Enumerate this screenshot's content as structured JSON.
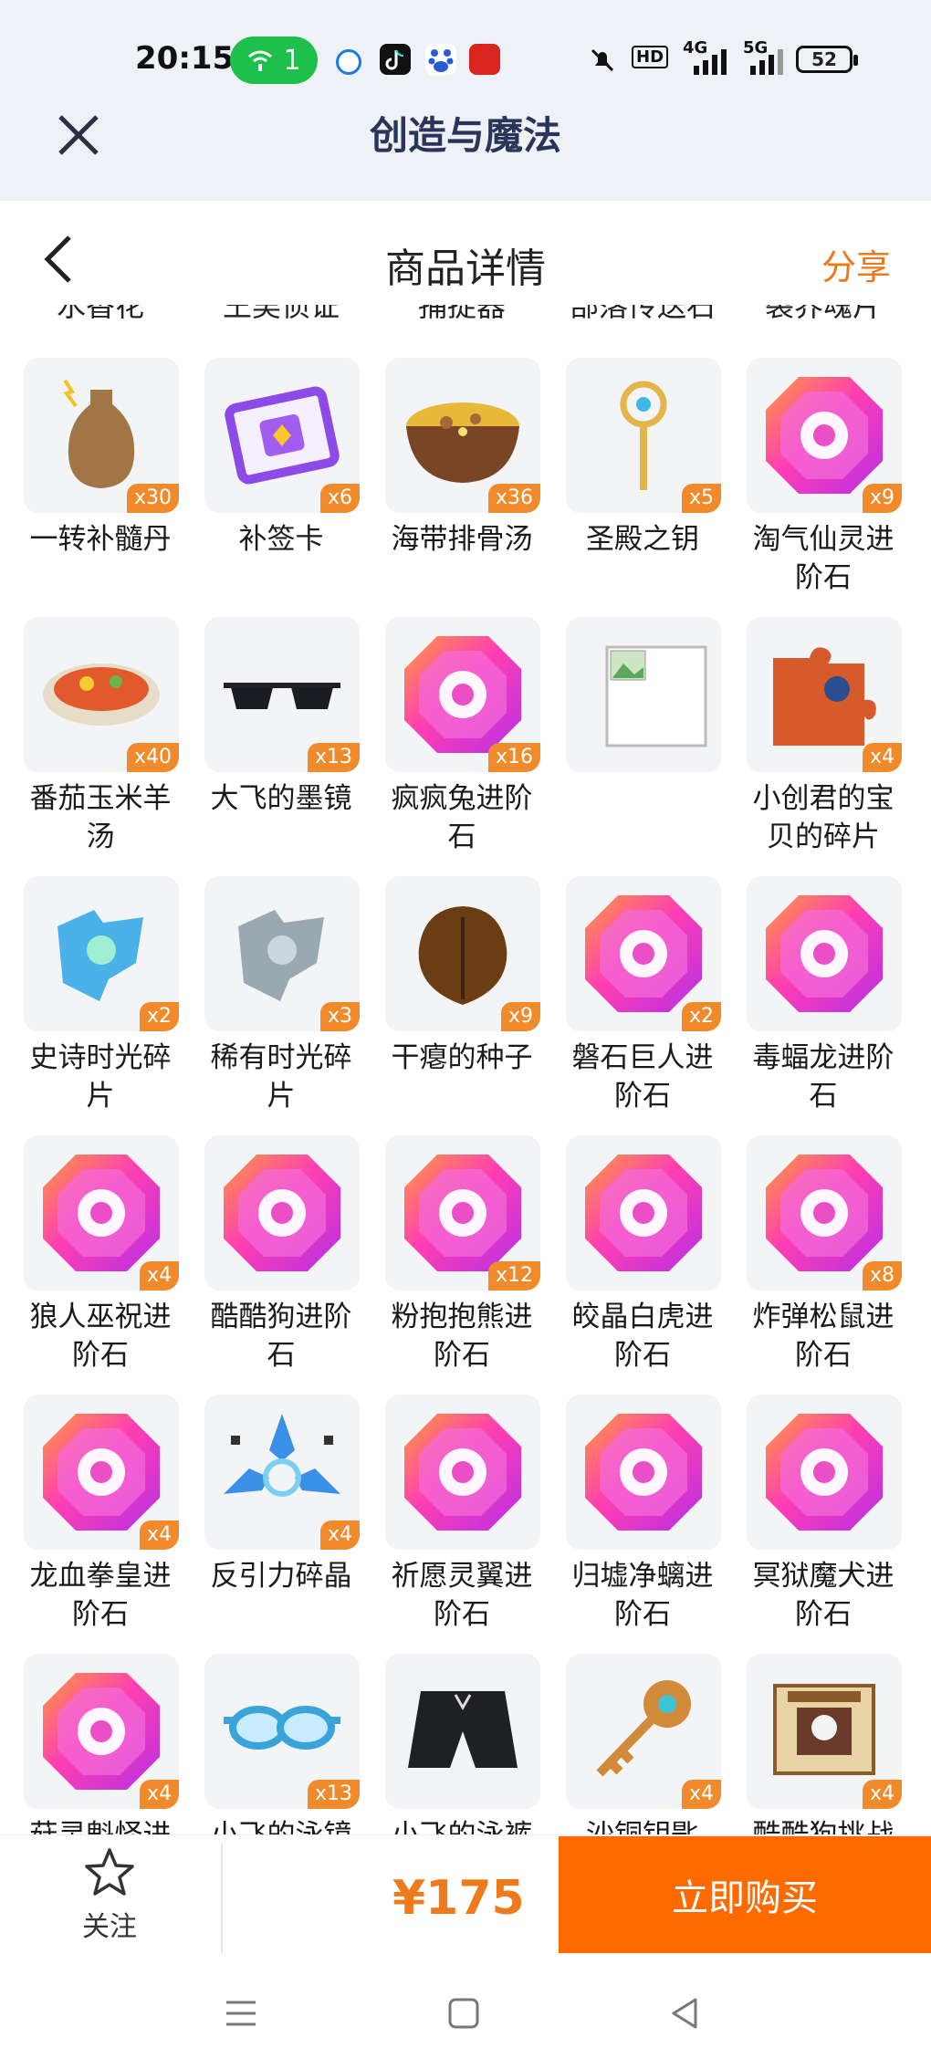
{
  "status_bar": {
    "time": "20:15",
    "hotspot_count": "1",
    "hd_label": "HD",
    "net1": "4G",
    "net2": "5G",
    "battery": "52"
  },
  "app_bar": {
    "title": "创造与魔法"
  },
  "header": {
    "title": "商品详情",
    "share_label": "分享"
  },
  "cut_row": [
    "水香花",
    "王吴侦证",
    "捕捉器",
    "部落传送石",
    "裂界魂片"
  ],
  "items": [
    {
      "name": "一转补髓丹",
      "qty": "x30",
      "icon": "vase-icon"
    },
    {
      "name": "补签卡",
      "qty": "x6",
      "icon": "ticket-icon"
    },
    {
      "name": "海带排骨汤",
      "qty": "x36",
      "icon": "soup-bowl-icon"
    },
    {
      "name": "圣殿之钥",
      "qty": "x5",
      "icon": "scepter-key-icon"
    },
    {
      "name": "淘气仙灵进阶石",
      "qty": "x9",
      "icon": "gem-icon"
    },
    {
      "name": "番茄玉米羊汤",
      "qty": "x40",
      "icon": "stew-pot-icon"
    },
    {
      "name": "大飞的墨镜",
      "qty": "x13",
      "icon": "sunglasses-icon"
    },
    {
      "name": "疯疯兔进阶石",
      "qty": "x16",
      "icon": "gem-icon"
    },
    {
      "name": "",
      "qty": "",
      "icon": "broken-image-icon"
    },
    {
      "name": "小创君的宝贝的碎片",
      "qty": "x4",
      "icon": "puzzle-icon"
    },
    {
      "name": "史诗时光碎片",
      "qty": "x2",
      "icon": "blue-shard-icon"
    },
    {
      "name": "稀有时光碎片",
      "qty": "x3",
      "icon": "grey-shard-icon"
    },
    {
      "name": "干瘪的种子",
      "qty": "x9",
      "icon": "seed-icon"
    },
    {
      "name": "磐石巨人进阶石",
      "qty": "x2",
      "icon": "gem-icon"
    },
    {
      "name": "毒蝠龙进阶石",
      "qty": "",
      "icon": "gem-icon"
    },
    {
      "name": "狼人巫祝进阶石",
      "qty": "x4",
      "icon": "gem-icon"
    },
    {
      "name": "酷酷狗进阶石",
      "qty": "",
      "icon": "gem-icon"
    },
    {
      "name": "粉抱抱熊进阶石",
      "qty": "x12",
      "icon": "gem-icon"
    },
    {
      "name": "皎晶白虎进阶石",
      "qty": "",
      "icon": "gem-icon"
    },
    {
      "name": "炸弹松鼠进阶石",
      "qty": "x8",
      "icon": "gem-icon"
    },
    {
      "name": "龙血拳皇进阶石",
      "qty": "x4",
      "icon": "gem-icon"
    },
    {
      "name": "反引力碎晶",
      "qty": "x4",
      "icon": "crystal-icon"
    },
    {
      "name": "祈愿灵翼进阶石",
      "qty": "",
      "icon": "gem-icon"
    },
    {
      "name": "归墟净螭进阶石",
      "qty": "",
      "icon": "gem-icon"
    },
    {
      "name": "冥狱魔犬进阶石",
      "qty": "",
      "icon": "gem-icon"
    },
    {
      "name": "菇灵魁怪进",
      "qty": "x4",
      "icon": "gem-icon"
    },
    {
      "name": "小飞的泳镜",
      "qty": "x13",
      "icon": "goggles-icon"
    },
    {
      "name": "小飞的泳裤",
      "qty": "",
      "icon": "shorts-icon"
    },
    {
      "name": "沙铜钥匙",
      "qty": "x4",
      "icon": "bronze-key-icon"
    },
    {
      "name": "酷酷狗挑战",
      "qty": "x4",
      "icon": "wanted-poster-icon"
    }
  ],
  "bottom": {
    "follow_label": "关注",
    "price": "¥175",
    "buy_label": "立即购买"
  },
  "colors": {
    "accent": "#ff6a00",
    "price": "#ee7a1b",
    "gem_pink": "#e43ad8"
  }
}
